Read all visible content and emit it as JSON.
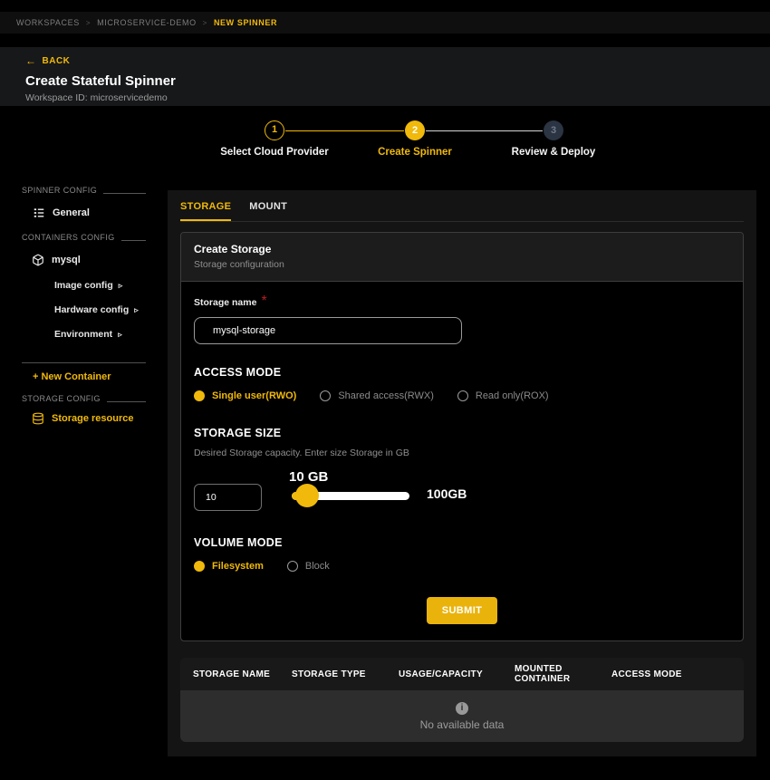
{
  "colors": {
    "accent": "#f0b90b"
  },
  "breadcrumb": {
    "separator": ">",
    "items": [
      "WORKSPACES",
      "MICROSERVICE-DEMO",
      "NEW SPINNER"
    ]
  },
  "header": {
    "back_arrow": "←",
    "back_label": "BACK",
    "title": "Create Stateful Spinner",
    "subtitle": "Workspace ID: microservicedemo"
  },
  "stepper": {
    "steps": [
      {
        "number": "1",
        "label": "Select Cloud Provider",
        "state": "completed"
      },
      {
        "number": "2",
        "label": "Create Spinner",
        "state": "active"
      },
      {
        "number": "3",
        "label": "Review & Deploy",
        "state": "upcoming"
      }
    ]
  },
  "sidebar": {
    "sections": [
      {
        "label": "SPINNER CONFIG"
      },
      {
        "label": "CONTAINERS CONFIG"
      },
      {
        "label": "STORAGE CONFIG"
      }
    ],
    "general_label": "General",
    "container_name": "mysql",
    "container_items": [
      {
        "label": "Image config",
        "expand_glyph": "▹"
      },
      {
        "label": "Hardware config",
        "expand_glyph": "▹"
      },
      {
        "label": "Environment",
        "expand_glyph": "▹"
      }
    ],
    "new_container_label": "+ New Container",
    "storage_resource_label": "Storage resource"
  },
  "main": {
    "tabs": [
      {
        "label": "STORAGE",
        "active": true
      },
      {
        "label": "MOUNT",
        "active": false
      }
    ],
    "card": {
      "title": "Create Storage",
      "subtitle": "Storage configuration",
      "storage_name": {
        "label": "Storage name",
        "required_mark": "*",
        "value": "mysql-storage"
      },
      "access_mode": {
        "heading": "ACCESS MODE",
        "options": [
          {
            "label": "Single user(RWO)",
            "selected": true
          },
          {
            "label": "Shared access(RWX)",
            "selected": false
          },
          {
            "label": "Read only(ROX)",
            "selected": false
          }
        ]
      },
      "storage_size": {
        "heading": "STORAGE SIZE",
        "description": "Desired Storage capacity. Enter size Storage in GB",
        "value": "10",
        "value_label": "10 GB",
        "max_label": "100GB",
        "min": 10,
        "max": 100
      },
      "volume_mode": {
        "heading": "VOLUME MODE",
        "options": [
          {
            "label": "Filesystem",
            "selected": true
          },
          {
            "label": "Block",
            "selected": false
          }
        ]
      },
      "submit_label": "SUBMIT"
    },
    "table": {
      "columns": [
        "STORAGE NAME",
        "STORAGE TYPE",
        "USAGE/CAPACITY",
        "MOUNTED CONTAINER",
        "ACCESS MODE"
      ],
      "empty_icon": "i",
      "empty_text": "No available data"
    }
  }
}
